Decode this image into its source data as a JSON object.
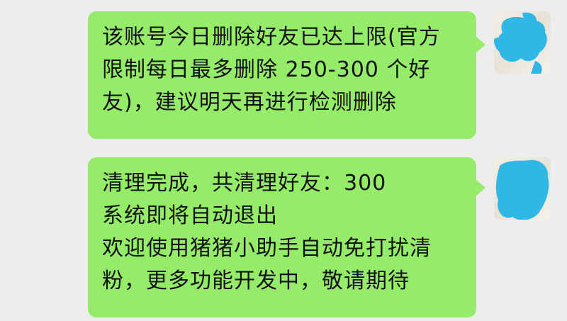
{
  "messages": [
    {
      "side": "right",
      "lines": [
        "该账号今日删除好友已达上限(官方",
        "限制每日最多删除 250-300 个好",
        "友)，建议明天再进行检测删除"
      ]
    },
    {
      "side": "right",
      "lines": [
        "清理完成，共清理好友：300",
        "系统即将自动退出",
        "欢迎使用猪猪小助手自动免打扰清",
        "粉，更多功能开发中，敬请期待"
      ]
    }
  ],
  "colors": {
    "background": "#ededed",
    "bubble": "#95ec69",
    "text": "#111111",
    "avatar_redaction": "#2fb7e6"
  },
  "icons": [
    "redacted-avatar-icon"
  ]
}
